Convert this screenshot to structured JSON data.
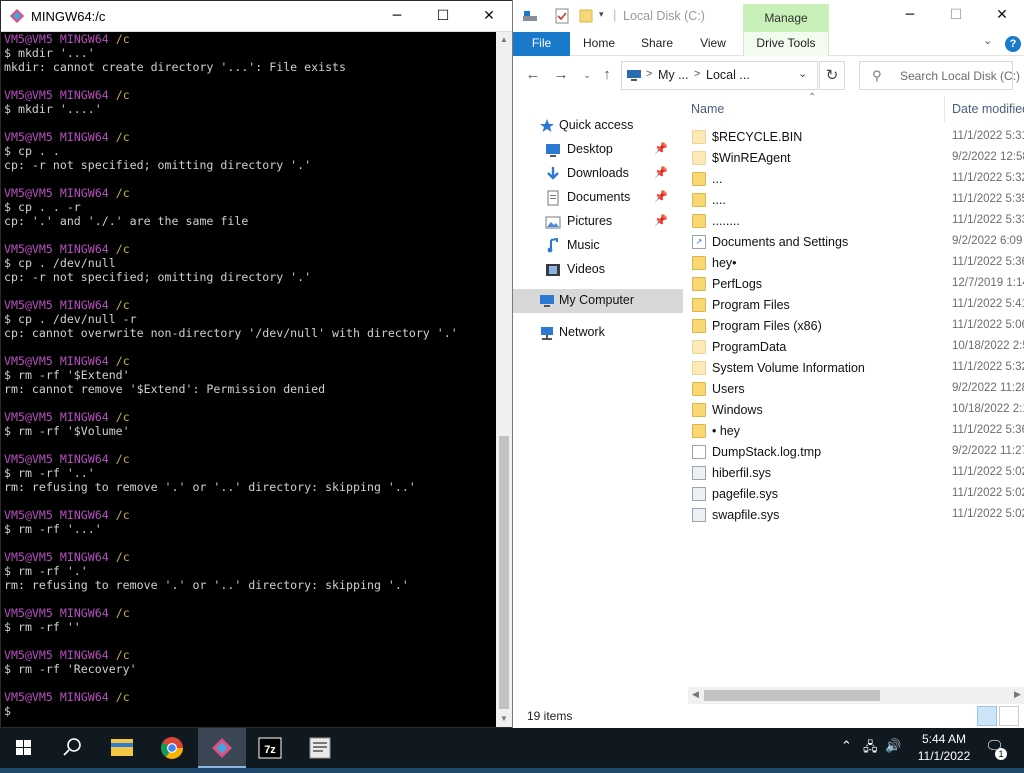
{
  "terminal": {
    "title": "MINGW64:/c",
    "minimize": "─",
    "maximize": "☐",
    "close": "✕",
    "lines": [
      {
        "kind": "prompt",
        "user": "VM5@VM5",
        "env": "MINGW64",
        "dir": "/c"
      },
      {
        "kind": "text",
        "text": "$ mkdir '...'"
      },
      {
        "kind": "text",
        "text": "mkdir: cannot create directory '...': File exists"
      },
      {
        "kind": "blank",
        "text": ""
      },
      {
        "kind": "prompt",
        "user": "VM5@VM5",
        "env": "MINGW64",
        "dir": "/c"
      },
      {
        "kind": "text",
        "text": "$ mkdir '....'"
      },
      {
        "kind": "blank",
        "text": ""
      },
      {
        "kind": "prompt",
        "user": "VM5@VM5",
        "env": "MINGW64",
        "dir": "/c"
      },
      {
        "kind": "text",
        "text": "$ cp . ."
      },
      {
        "kind": "text",
        "text": "cp: -r not specified; omitting directory '.'"
      },
      {
        "kind": "blank",
        "text": ""
      },
      {
        "kind": "prompt",
        "user": "VM5@VM5",
        "env": "MINGW64",
        "dir": "/c"
      },
      {
        "kind": "text",
        "text": "$ cp . . -r"
      },
      {
        "kind": "text",
        "text": "cp: '.' and './.' are the same file"
      },
      {
        "kind": "blank",
        "text": ""
      },
      {
        "kind": "prompt",
        "user": "VM5@VM5",
        "env": "MINGW64",
        "dir": "/c"
      },
      {
        "kind": "text",
        "text": "$ cp . /dev/null"
      },
      {
        "kind": "text",
        "text": "cp: -r not specified; omitting directory '.'"
      },
      {
        "kind": "blank",
        "text": ""
      },
      {
        "kind": "prompt",
        "user": "VM5@VM5",
        "env": "MINGW64",
        "dir": "/c"
      },
      {
        "kind": "text",
        "text": "$ cp . /dev/null -r"
      },
      {
        "kind": "text",
        "text": "cp: cannot overwrite non-directory '/dev/null' with directory '.'"
      },
      {
        "kind": "blank",
        "text": ""
      },
      {
        "kind": "prompt",
        "user": "VM5@VM5",
        "env": "MINGW64",
        "dir": "/c"
      },
      {
        "kind": "text",
        "text": "$ rm -rf '$Extend'"
      },
      {
        "kind": "text",
        "text": "rm: cannot remove '$Extend': Permission denied"
      },
      {
        "kind": "blank",
        "text": ""
      },
      {
        "kind": "prompt",
        "user": "VM5@VM5",
        "env": "MINGW64",
        "dir": "/c"
      },
      {
        "kind": "text",
        "text": "$ rm -rf '$Volume'"
      },
      {
        "kind": "blank",
        "text": ""
      },
      {
        "kind": "prompt",
        "user": "VM5@VM5",
        "env": "MINGW64",
        "dir": "/c"
      },
      {
        "kind": "text",
        "text": "$ rm -rf '..'"
      },
      {
        "kind": "text",
        "text": "rm: refusing to remove '.' or '..' directory: skipping '..'"
      },
      {
        "kind": "blank",
        "text": ""
      },
      {
        "kind": "prompt",
        "user": "VM5@VM5",
        "env": "MINGW64",
        "dir": "/c"
      },
      {
        "kind": "text",
        "text": "$ rm -rf '...'"
      },
      {
        "kind": "blank",
        "text": ""
      },
      {
        "kind": "prompt",
        "user": "VM5@VM5",
        "env": "MINGW64",
        "dir": "/c"
      },
      {
        "kind": "text",
        "text": "$ rm -rf '.'"
      },
      {
        "kind": "text",
        "text": "rm: refusing to remove '.' or '..' directory: skipping '.'"
      },
      {
        "kind": "blank",
        "text": ""
      },
      {
        "kind": "prompt",
        "user": "VM5@VM5",
        "env": "MINGW64",
        "dir": "/c"
      },
      {
        "kind": "text",
        "text": "$ rm -rf ''"
      },
      {
        "kind": "blank",
        "text": ""
      },
      {
        "kind": "prompt",
        "user": "VM5@VM5",
        "env": "MINGW64",
        "dir": "/c"
      },
      {
        "kind": "text",
        "text": "$ rm -rf 'Recovery'"
      },
      {
        "kind": "blank",
        "text": ""
      },
      {
        "kind": "prompt",
        "user": "VM5@VM5",
        "env": "MINGW64",
        "dir": "/c"
      },
      {
        "kind": "text",
        "text": "$"
      }
    ]
  },
  "explorer": {
    "title": "Local Disk (C:)",
    "manage_tab": "Manage",
    "minimize": "─",
    "maximize": "☐",
    "close": "✕",
    "ribbon_tabs": [
      "File",
      "Home",
      "Share",
      "View",
      "Drive Tools"
    ],
    "address": {
      "seg1": "My ...",
      "seg2": "Local ...",
      "sep": ">"
    },
    "search_placeholder": "Search Local Disk (C:)",
    "nav_items": [
      {
        "label": "Quick access",
        "icon": "star-icon",
        "pinned": false,
        "selected": false
      },
      {
        "label": "Desktop",
        "icon": "desktop-icon",
        "pinned": true,
        "selected": false
      },
      {
        "label": "Downloads",
        "icon": "download-icon",
        "pinned": true,
        "selected": false
      },
      {
        "label": "Documents",
        "icon": "documents-icon",
        "pinned": true,
        "selected": false
      },
      {
        "label": "Pictures",
        "icon": "pictures-icon",
        "pinned": true,
        "selected": false
      },
      {
        "label": "Music",
        "icon": "music-icon",
        "pinned": false,
        "selected": false
      },
      {
        "label": "Videos",
        "icon": "videos-icon",
        "pinned": false,
        "selected": false
      },
      {
        "label": "My Computer",
        "icon": "computer-icon",
        "pinned": false,
        "selected": true
      },
      {
        "label": "Network",
        "icon": "network-icon",
        "pinned": false,
        "selected": false
      }
    ],
    "columns": {
      "name": "Name",
      "date": "Date modified"
    },
    "files": [
      {
        "name": "$RECYCLE.BIN",
        "date": "11/1/2022 5:31",
        "type": "folder",
        "faded": true
      },
      {
        "name": "$WinREAgent",
        "date": "9/2/2022 12:58",
        "type": "folder",
        "faded": true
      },
      {
        "name": "...",
        "date": "11/1/2022 5:32",
        "type": "folder",
        "faded": false
      },
      {
        "name": "....",
        "date": "11/1/2022 5:35",
        "type": "folder",
        "faded": false
      },
      {
        "name": "........",
        "date": "11/1/2022 5:33",
        "type": "folder",
        "faded": false
      },
      {
        "name": "Documents and Settings",
        "date": "9/2/2022 6:09",
        "type": "link",
        "faded": false
      },
      {
        "name": "hey•",
        "date": "11/1/2022 5:36",
        "type": "folder",
        "faded": false
      },
      {
        "name": "PerfLogs",
        "date": "12/7/2019 1:14",
        "type": "folder",
        "faded": false
      },
      {
        "name": "Program Files",
        "date": "11/1/2022 5:41",
        "type": "folder",
        "faded": false
      },
      {
        "name": "Program Files (x86)",
        "date": "11/1/2022 5:06",
        "type": "folder",
        "faded": false
      },
      {
        "name": "ProgramData",
        "date": "10/18/2022 2:5",
        "type": "folder",
        "faded": true
      },
      {
        "name": "System Volume Information",
        "date": "11/1/2022 5:32",
        "type": "folder",
        "faded": true
      },
      {
        "name": "Users",
        "date": "9/2/2022 11:28",
        "type": "folder",
        "faded": false
      },
      {
        "name": "Windows",
        "date": "10/18/2022 2:1",
        "type": "folder",
        "faded": false
      },
      {
        "name": "• hey",
        "date": "11/1/2022 5:36",
        "type": "folder",
        "faded": false
      },
      {
        "name": "DumpStack.log.tmp",
        "date": "9/2/2022 11:27",
        "type": "file",
        "faded": false
      },
      {
        "name": "hiberfil.sys",
        "date": "11/1/2022 5:02",
        "type": "sys",
        "faded": false
      },
      {
        "name": "pagefile.sys",
        "date": "11/1/2022 5:02",
        "type": "sys",
        "faded": false
      },
      {
        "name": "swapfile.sys",
        "date": "11/1/2022 5:02",
        "type": "sys",
        "faded": false
      }
    ],
    "status": "19 items"
  },
  "taskbar": {
    "apps": [
      "start-icon",
      "search-icon",
      "file-explorer-icon",
      "chrome-icon",
      "git-bash-icon",
      "7zip-icon",
      "notepad-icon"
    ],
    "time": "5:44 AM",
    "date": "11/1/2022",
    "notifications": "1"
  }
}
